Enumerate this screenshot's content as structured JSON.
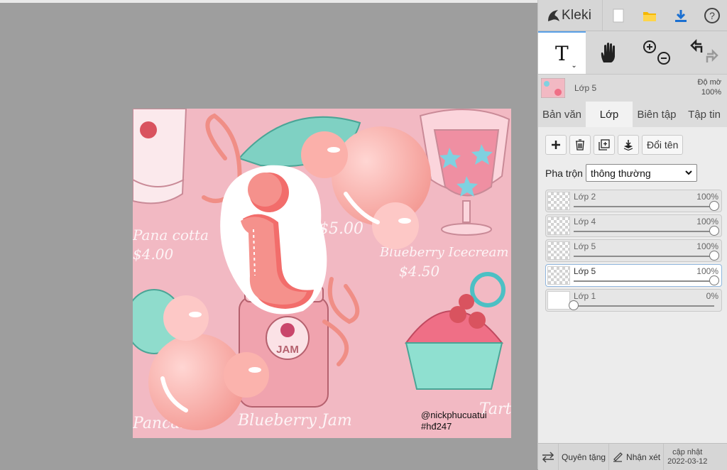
{
  "app": {
    "name": "Kleki"
  },
  "header_buttons": [
    {
      "name": "new-image",
      "icon": "blank-page-icon"
    },
    {
      "name": "open-image",
      "icon": "folder-icon"
    },
    {
      "name": "save-image",
      "icon": "download-icon"
    },
    {
      "name": "help",
      "icon": "question-icon"
    }
  ],
  "tools": {
    "text_tool": "T",
    "active": "text"
  },
  "layer_info": {
    "name": "Lớp 5",
    "opacity_label": "Độ mờ",
    "opacity_value": "100%"
  },
  "tabs": [
    {
      "label": "Bản văn",
      "active": false
    },
    {
      "label": "Lớp",
      "active": true
    },
    {
      "label": "Biên tập",
      "active": false
    },
    {
      "label": "Tập tin",
      "active": false
    }
  ],
  "layer_buttons": {
    "rename_label": "Đổi tên"
  },
  "blend": {
    "label": "Pha trộn",
    "value": "thông thường"
  },
  "layers": [
    {
      "name": "Lớp 2",
      "opacity": "100%",
      "level": 1.0,
      "selected": false
    },
    {
      "name": "Lớp 4",
      "opacity": "100%",
      "level": 1.0,
      "selected": false
    },
    {
      "name": "Lớp 5",
      "opacity": "100%",
      "level": 1.0,
      "selected": false
    },
    {
      "name": "Lớp 5",
      "opacity": "100%",
      "level": 1.0,
      "selected": true
    },
    {
      "name": "Lớp 1",
      "opacity": "0%",
      "level": 0.0,
      "selected": false
    }
  ],
  "canvas": {
    "labels": {
      "panna": "Pana cotta",
      "panna_price": "$4.00",
      "price_top": "$5.00",
      "blueberry_icecream": "Blueberry Icecream",
      "icecream_price": "$4.50",
      "jam": "JAM",
      "pancakes": "Pancakes",
      "blueberry_jam": "Blueberry Jam",
      "tart": "Tart",
      "credit_handle": "@nickphucuatui",
      "credit_tag": "#hđ247"
    }
  },
  "footer": {
    "share_label": "Quyên tặng",
    "feedback_label": "Nhận xét",
    "update_label": "cập nhật",
    "update_date": "2022-03-12"
  },
  "colors": {
    "accent": "#5aa0e6",
    "canvas_bg": "#f2b8c2",
    "panel": "#dcdcdc"
  }
}
